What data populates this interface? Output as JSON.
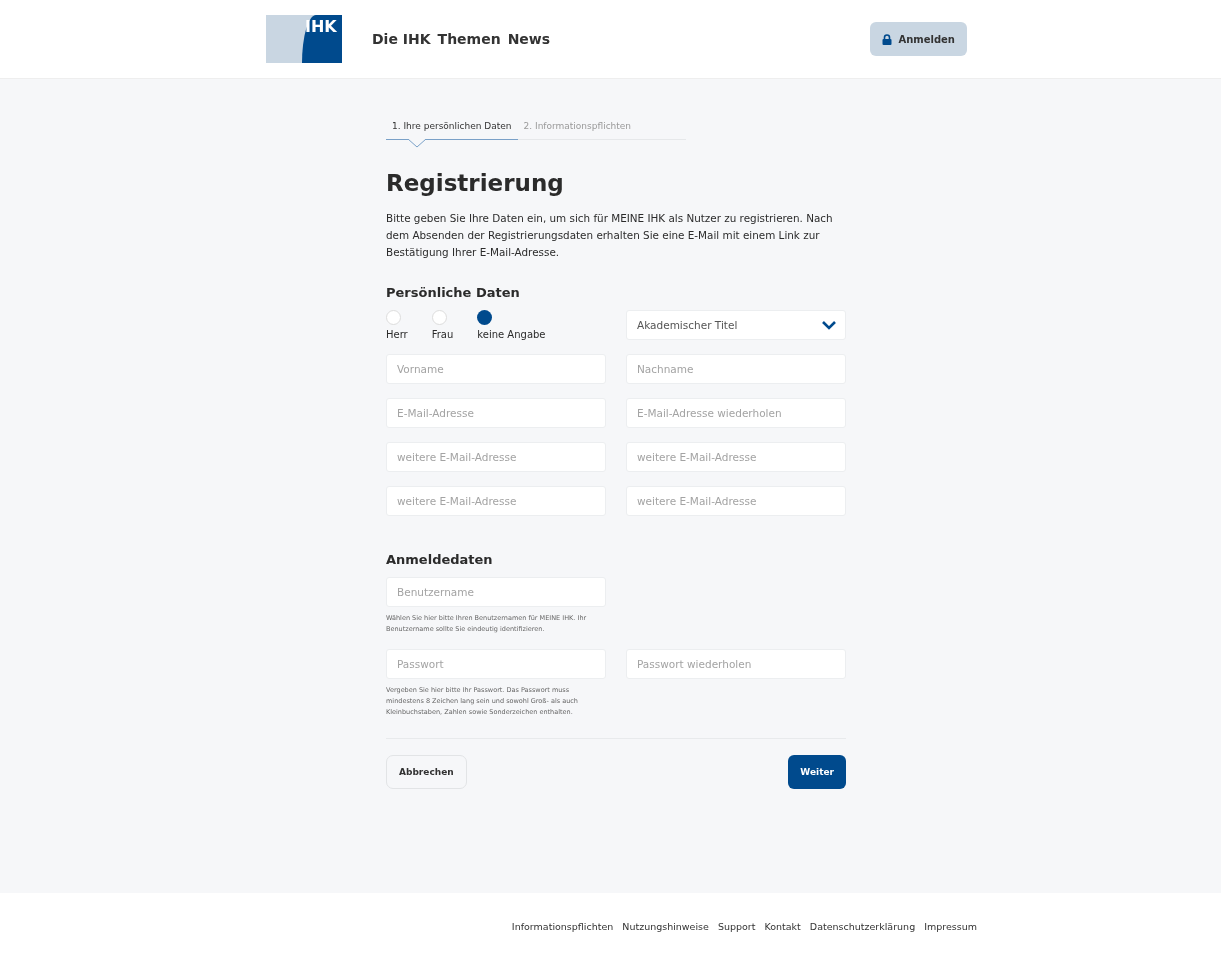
{
  "header": {
    "logo": "IHK",
    "nav": [
      "Die IHK",
      "Themen",
      "News"
    ],
    "login_button": "Anmelden"
  },
  "steps": [
    {
      "label": "1.  Ihre persönlichen Daten",
      "selected": true
    },
    {
      "label": "2.  Informationspflichten",
      "selected": false
    }
  ],
  "title": "Registrierung",
  "intro": "Bitte geben Sie Ihre Daten ein, um sich für MEINE IHK als Nutzer zu registrieren. Nach dem Absenden der Registrierungsdaten erhalten Sie eine E-Mail mit einem Link zur Bestätigung Ihrer E-Mail-Adresse.",
  "personal": {
    "heading": "Persönliche Daten",
    "salutation": [
      {
        "label": "Herr",
        "selected": false
      },
      {
        "label": "Frau",
        "selected": false
      },
      {
        "label": "keine Angabe",
        "selected": true
      }
    ],
    "title_select": {
      "placeholder": "Akademischer Titel"
    },
    "fields": [
      {
        "placeholder": "Vorname"
      },
      {
        "placeholder": "Nachname"
      },
      {
        "placeholder": "E-Mail-Adresse"
      },
      {
        "placeholder": "E-Mail-Adresse wiederholen"
      },
      {
        "placeholder": "weitere E-Mail-Adresse"
      },
      {
        "placeholder": "weitere E-Mail-Adresse"
      },
      {
        "placeholder": "weitere E-Mail-Adresse"
      },
      {
        "placeholder": "weitere E-Mail-Adresse"
      }
    ]
  },
  "login": {
    "heading": "Anmeldedaten",
    "username": {
      "placeholder": "Benutzername",
      "hint": "Wählen Sie hier bitte Ihren Benutzernamen für MEINE IHK. Ihr Benutzername sollte Sie eindeutig identifizieren."
    },
    "password": {
      "placeholder": "Passwort",
      "hint": "Vergeben Sie hier bitte Ihr Passwort. Das Passwort muss mindestens 8 Zeichen lang sein und sowohl Groß- als auch Kleinbuchstaben, Zahlen sowie Sonderzeichen enthalten."
    },
    "password_repeat": {
      "placeholder": "Passwort wiederholen"
    }
  },
  "actions": {
    "cancel": "Abbrechen",
    "next": "Weiter"
  },
  "footer": [
    "Informationspflichten",
    "Nutzungshinweise",
    "Support",
    "Kontakt",
    "Datenschutzerklärung",
    "Impressum"
  ]
}
